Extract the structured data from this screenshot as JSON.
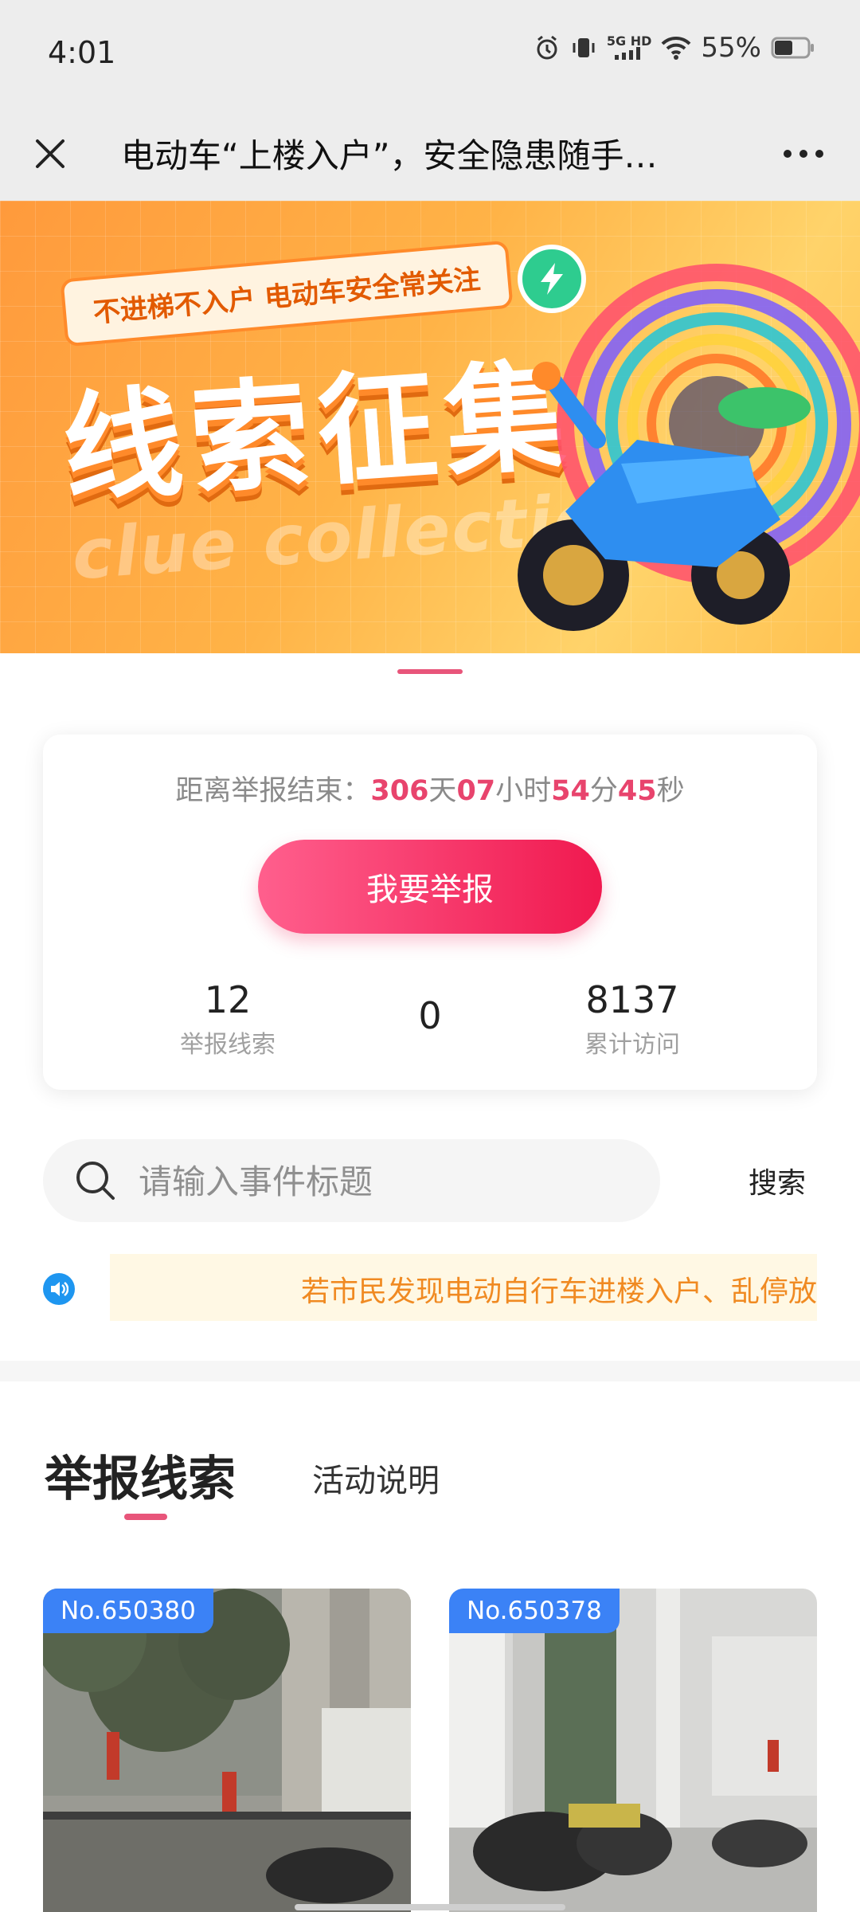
{
  "status_bar": {
    "time": "4:01",
    "network": "5G HD",
    "battery": "55%"
  },
  "nav": {
    "title": "电动车“上楼入户”，安全隐患随手…"
  },
  "banner": {
    "tag": "不进梯不入户 电动车安全常关注",
    "title": "线索征集",
    "subtitle": "clue collection"
  },
  "countdown": {
    "label": "距离举报结束：",
    "days": "306",
    "days_unit": "天",
    "hours": "07",
    "hours_unit": "小时",
    "minutes": "54",
    "minutes_unit": "分",
    "seconds": "45",
    "seconds_unit": "秒"
  },
  "report_button": "我要举报",
  "stats": [
    {
      "value": "12",
      "label": "举报线索"
    },
    {
      "value": "0",
      "label": ""
    },
    {
      "value": "8137",
      "label": "累计访问"
    }
  ],
  "search": {
    "placeholder": "请输入事件标题",
    "button": "搜索"
  },
  "notice": {
    "text": "若市民发现电动自行车进楼入户、乱停放"
  },
  "tabs": {
    "main": "举报线索",
    "second": "活动说明"
  },
  "items": [
    {
      "number": "No.650380"
    },
    {
      "number": "No.650378"
    }
  ],
  "colors": {
    "accent": "#e8446d",
    "notice": "#f08a22",
    "badge": "#3b82f6",
    "speaker": "#1e96f0"
  }
}
